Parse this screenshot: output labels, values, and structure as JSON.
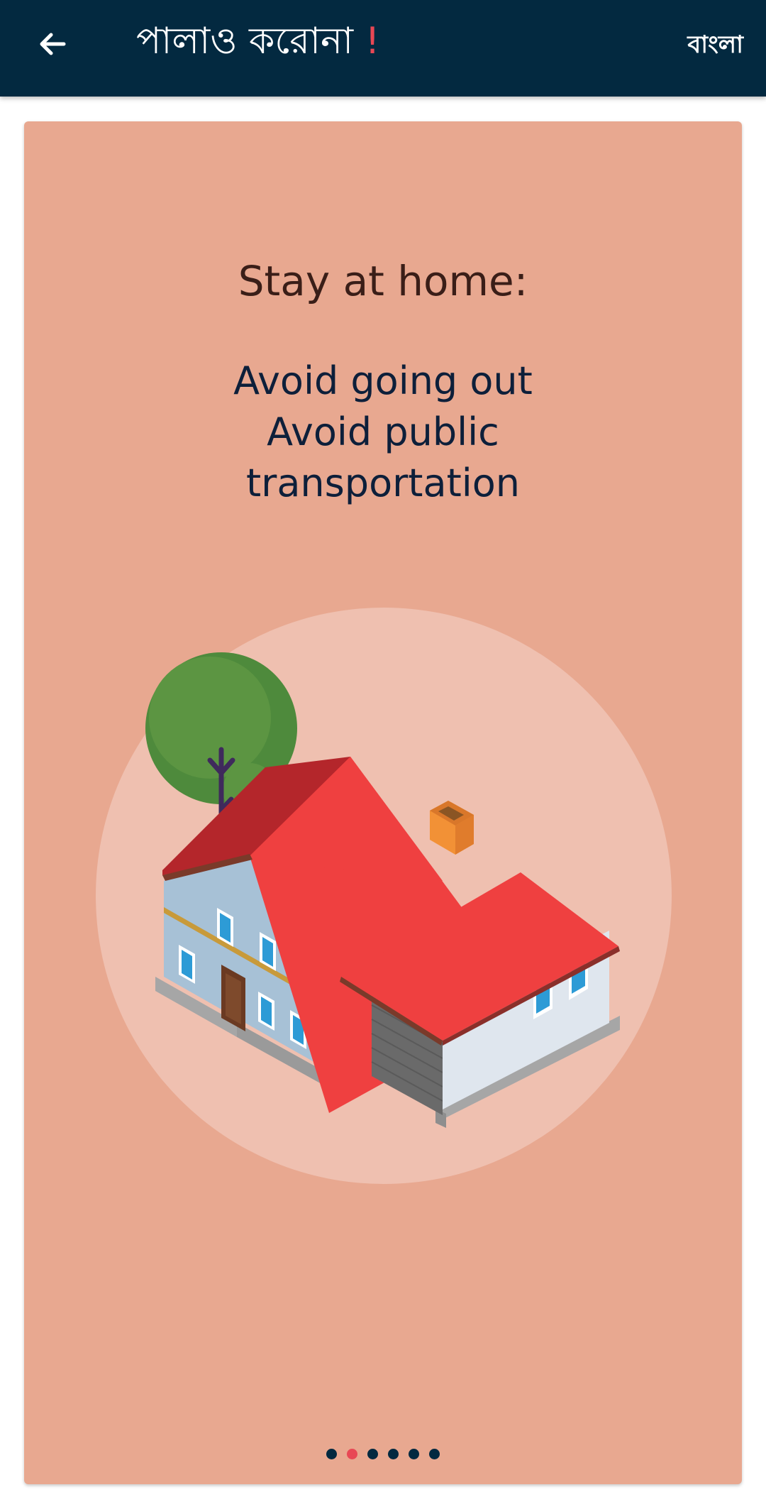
{
  "appbar": {
    "title_text": "পালাও করোনা ",
    "title_accent": "!",
    "language_button": "বাংলা"
  },
  "slide": {
    "heading": "Stay at home:",
    "lines": [
      "Avoid going out",
      "Avoid public",
      "transportation"
    ]
  },
  "pager": {
    "total": 6,
    "current": 2
  },
  "colors": {
    "appbar": "#032940",
    "card": "#e8a890",
    "accent": "#e84855"
  },
  "icons": {
    "back": "arrow-left-icon",
    "illustration": "house-illustration"
  }
}
